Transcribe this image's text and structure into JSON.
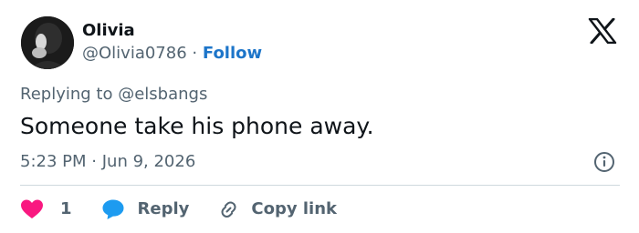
{
  "author": {
    "name": "Olivia",
    "handle": "@Olivia0786",
    "separator": "·",
    "follow_label": "Follow"
  },
  "tweet": {
    "replying_prefix": "Replying to",
    "replying_to": "@elsbangs",
    "text": "Someone take his phone away.",
    "time": "5:23 PM",
    "date": "Jun 9, 2026"
  },
  "actions": {
    "like_count": "1",
    "reply_label": "Reply",
    "copy_link_label": "Copy link"
  },
  "icons": {
    "brand": "x-logo-icon",
    "info": "info-icon",
    "like": "heart-icon",
    "reply": "speech-bubble-icon",
    "copy": "link-icon"
  },
  "colors": {
    "accent": "#1d75c9",
    "like": "#f91880",
    "reply": "#1d9bf0",
    "secondary_text": "#536471"
  }
}
